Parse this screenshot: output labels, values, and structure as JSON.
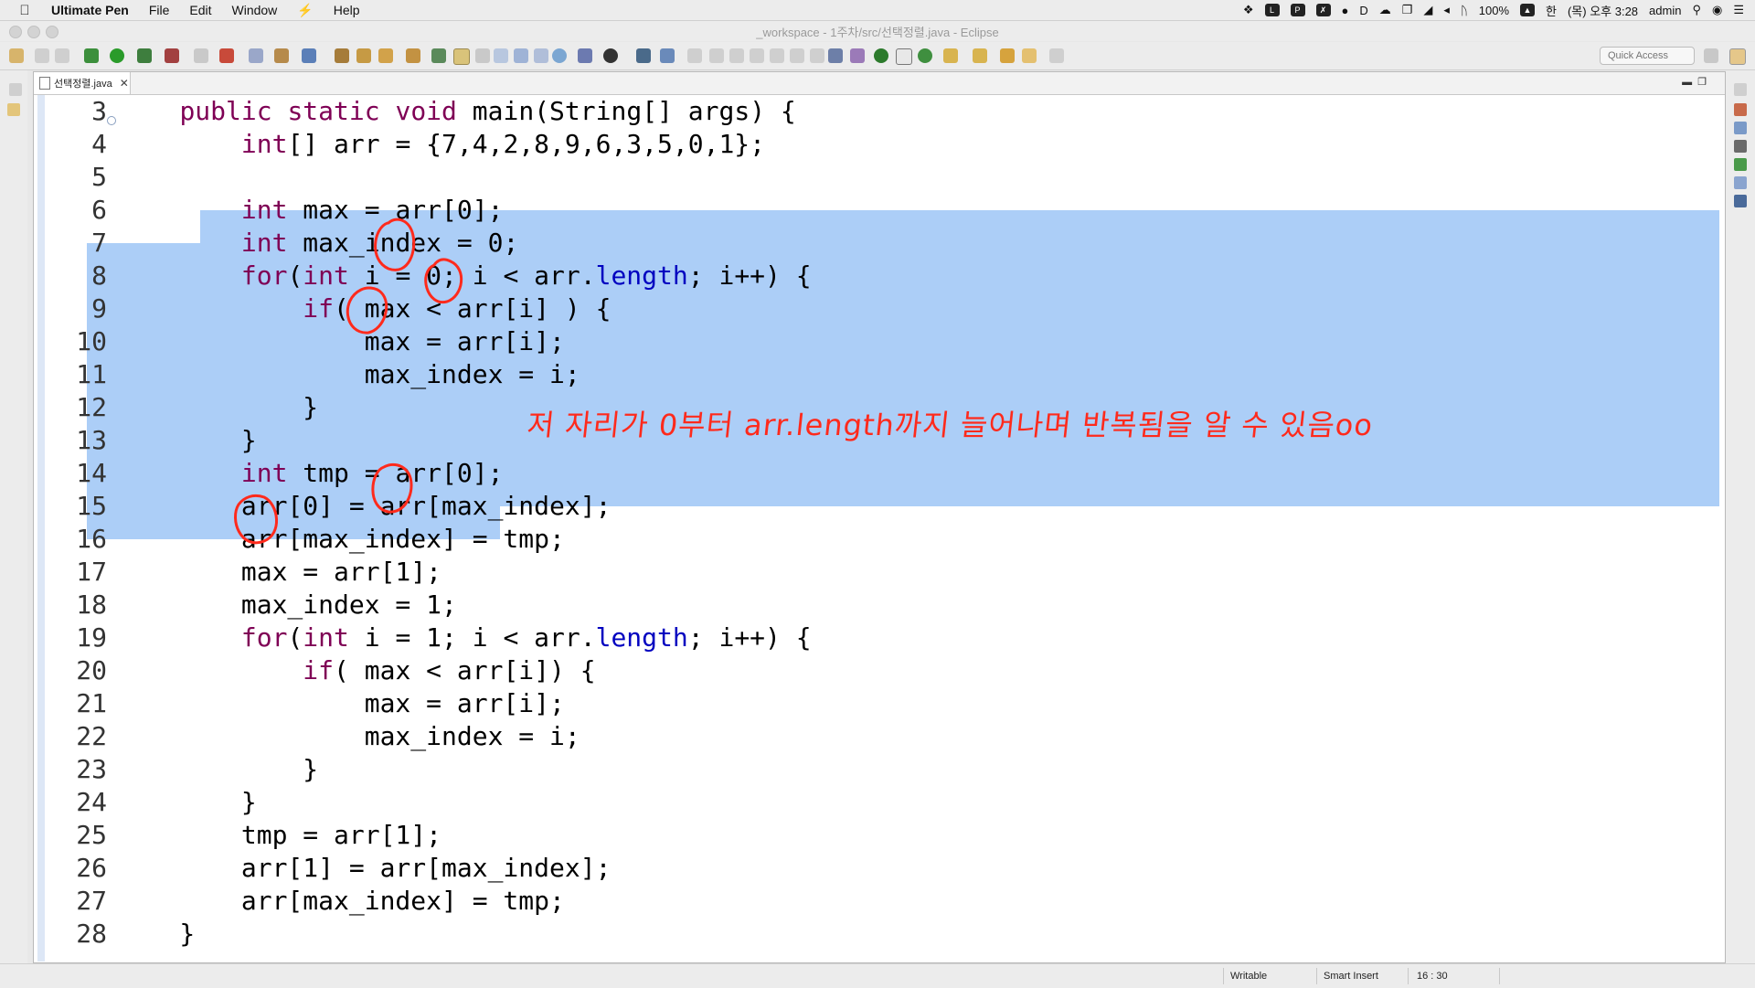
{
  "menubar": {
    "app_name": "Ultimate Pen",
    "menus": [
      "File",
      "Edit",
      "Window",
      "Help"
    ],
    "battery": "100%",
    "clock": "(목) 오후 3:28",
    "user": "admin",
    "input_method": "한"
  },
  "window": {
    "title": "_workspace - 1주차/src/선택정렬.java - Eclipse"
  },
  "toolbar": {
    "quick_access_placeholder": "Quick Access"
  },
  "editor": {
    "tab_label": "선택정렬.java",
    "tab_close": "✕",
    "lines": [
      {
        "num": "3",
        "code": "    public static void main(String[] args) {"
      },
      {
        "num": "4",
        "code": "        int[] arr = {7,4,2,8,9,6,3,5,0,1};"
      },
      {
        "num": "5",
        "code": ""
      },
      {
        "num": "6",
        "code": "        int max = arr[0];"
      },
      {
        "num": "7",
        "code": "        int max_index = 0;"
      },
      {
        "num": "8",
        "code": "        for(int i = 0; i < arr.length; i++) {"
      },
      {
        "num": "9",
        "code": "            if( max < arr[i] ) {"
      },
      {
        "num": "10",
        "code": "                max = arr[i];"
      },
      {
        "num": "11",
        "code": "                max_index = i;"
      },
      {
        "num": "12",
        "code": "            }"
      },
      {
        "num": "13",
        "code": "        }"
      },
      {
        "num": "14",
        "code": "        int tmp = arr[0];"
      },
      {
        "num": "15",
        "code": "        arr[0] = arr[max_index];"
      },
      {
        "num": "16",
        "code": "        arr[max_index] = tmp;"
      },
      {
        "num": "17",
        "code": "        max = arr[1];"
      },
      {
        "num": "18",
        "code": "        max_index = 1;"
      },
      {
        "num": "19",
        "code": "        for(int i = 1; i < arr.length; i++) {"
      },
      {
        "num": "20",
        "code": "            if( max < arr[i]) {"
      },
      {
        "num": "21",
        "code": "                max = arr[i];"
      },
      {
        "num": "22",
        "code": "                max_index = i;"
      },
      {
        "num": "23",
        "code": "            }"
      },
      {
        "num": "24",
        "code": "        }"
      },
      {
        "num": "25",
        "code": "        tmp = arr[1];"
      },
      {
        "num": "26",
        "code": "        arr[1] = arr[max_index];"
      },
      {
        "num": "27",
        "code": "        arr[max_index] = tmp;"
      },
      {
        "num": "28",
        "code": "    }"
      }
    ],
    "annotation_text": "저 자리가 0부터 arr.length까지 늘어나며 반복됨을 알 수 있음oo",
    "annotation_color": "#ff2a1c",
    "selection_color": "#accef7"
  },
  "statusbar": {
    "writable": "Writable",
    "insert_mode": "Smart Insert",
    "position": "16 : 30"
  }
}
